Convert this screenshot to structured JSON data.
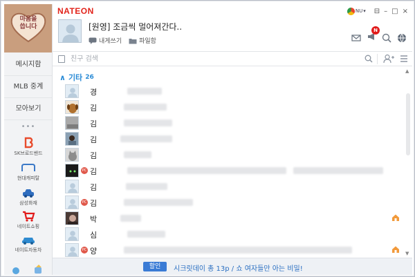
{
  "app": {
    "brand": "NATEON"
  },
  "account": {
    "label": "NU",
    "arrow": "▾"
  },
  "window_controls": {
    "pin": "⊟",
    "minimize": "–",
    "maximize": "□",
    "close": "×"
  },
  "sidebar": {
    "profile_art_text_1": "마음을",
    "profile_art_text_2": "씁니다",
    "menu": [
      {
        "label": "메시지함"
      },
      {
        "label": "MLB 중계"
      },
      {
        "label": "모아보기"
      }
    ],
    "more": "•••",
    "services": [
      {
        "label": "SK브로드밴드",
        "icon": "sk-broadband-icon",
        "color": "#e84b2c"
      },
      {
        "label": "현대캐피탈",
        "icon": "hyundai-capital-icon",
        "color": "#3b79c7"
      },
      {
        "label": "삼성화재",
        "icon": "samsung-fire-icon",
        "color": "#2f6dbf"
      },
      {
        "label": "네이트쇼핑",
        "icon": "shopping-cart-icon",
        "color": "#e11a1a"
      },
      {
        "label": "네이트자동차",
        "icon": "car-icon",
        "color": "#2e8ad0"
      }
    ]
  },
  "profile": {
    "status_message": "[원영] 조금씩 멀어져간다..",
    "actions": [
      {
        "label": "내게쓰기",
        "icon": "chat-bubble-icon"
      },
      {
        "label": "파일함",
        "icon": "folder-icon"
      }
    ],
    "notification_badge": "N"
  },
  "search": {
    "placeholder": "친구 검색"
  },
  "group": {
    "arrow": "∧",
    "name": "기타",
    "count": "26"
  },
  "friends": [
    {
      "name": "경",
      "pc": false,
      "pic": "default",
      "blur": [
        [
          50,
          50
        ]
      ]
    },
    {
      "name": "김",
      "pc": false,
      "pic": "dog",
      "blur": [
        [
          45,
          62
        ]
      ]
    },
    {
      "name": "김",
      "pc": false,
      "pic": "photo-gray",
      "blur": [
        [
          45,
          70
        ]
      ]
    },
    {
      "name": "김",
      "pc": false,
      "pic": "photo-person",
      "blur": [
        [
          40,
          75
        ]
      ]
    },
    {
      "name": "김",
      "pc": false,
      "pic": "cat",
      "blur": [
        [
          45,
          40
        ]
      ]
    },
    {
      "name": "김",
      "pc": true,
      "pic": "dark",
      "blur": [
        [
          50,
          230
        ],
        [
          290,
          130
        ]
      ]
    },
    {
      "name": "김",
      "pc": false,
      "pic": "default",
      "blur": [
        [
          48,
          60
        ]
      ]
    },
    {
      "name": "김",
      "pc": true,
      "pic": "default",
      "blur": [
        [
          45,
          100
        ]
      ]
    },
    {
      "name": "박",
      "pc": false,
      "pic": "photo-dark",
      "blur": [
        [
          40,
          30
        ]
      ],
      "home": true
    },
    {
      "name": "심",
      "pc": false,
      "pic": "default",
      "blur": [
        [
          50,
          55
        ]
      ]
    },
    {
      "name": "양",
      "pc": true,
      "pic": "default",
      "blur": [
        [
          45,
          330
        ]
      ],
      "home": true
    }
  ],
  "promo": {
    "tag": "할인",
    "text": "시크릿데이 총 13p / 쇼 여자들만 아는 비밀!"
  }
}
